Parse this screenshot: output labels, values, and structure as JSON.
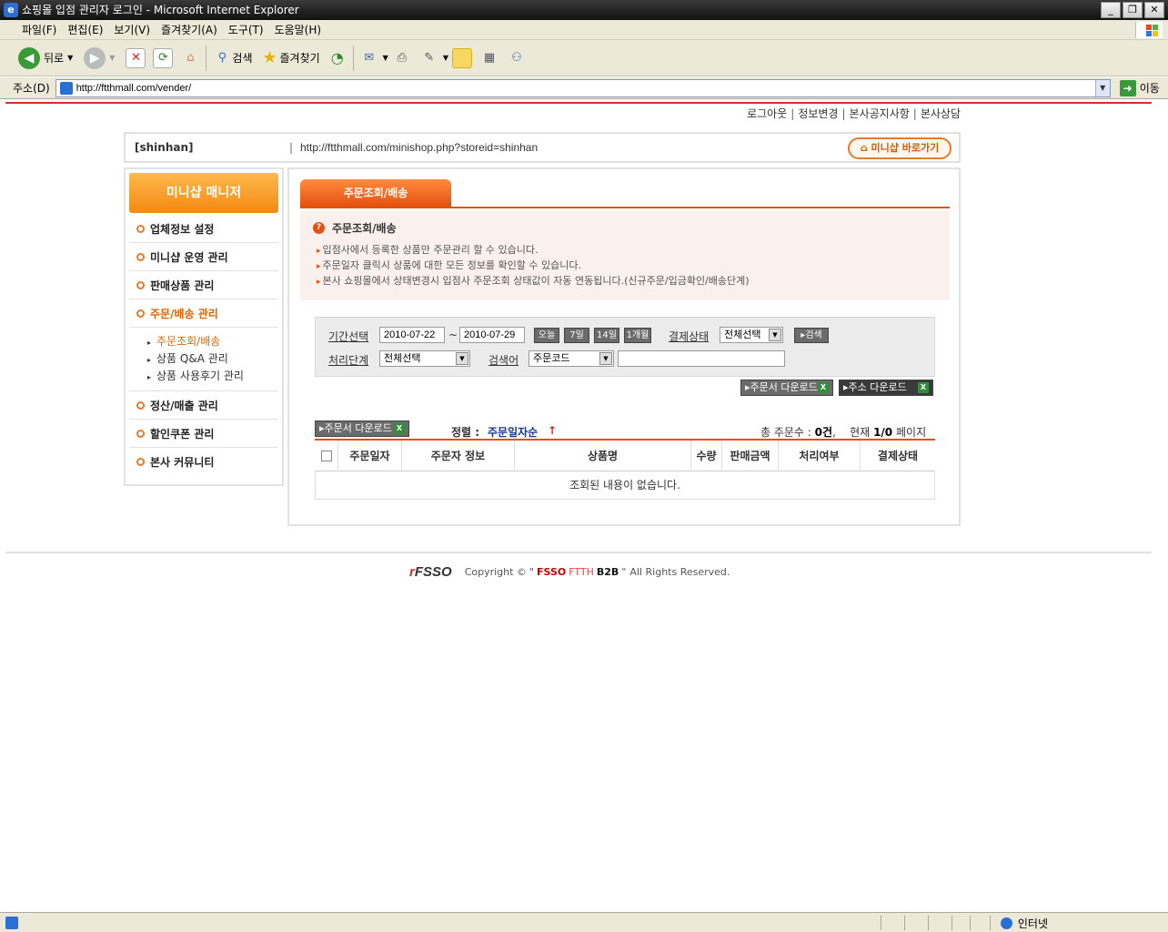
{
  "window": {
    "title": "쇼핑몰 입점 관리자 로그인 - Microsoft Internet Explorer"
  },
  "menu": [
    "파일(F)",
    "편집(E)",
    "보기(V)",
    "즐겨찾기(A)",
    "도구(T)",
    "도움말(H)"
  ],
  "toolbar": {
    "back_label": "뒤로",
    "search_label": "검색",
    "favorites_label": "즐겨찾기"
  },
  "address": {
    "label": "주소(D)",
    "url": "http://ftthmall.com/vender/",
    "go_label": "이동"
  },
  "top_links": [
    "로그아웃",
    "정보변경",
    "본사공지사항",
    "본사상담"
  ],
  "store": {
    "id": "[shinhan]",
    "divider": "|",
    "url": "http://ftthmall.com/minishop.php?storeid=shinhan",
    "minishop_button": "미니샵 바로가기"
  },
  "sidebar": {
    "header": "미니샵 매니저",
    "items": [
      {
        "label": "업체정보 설정"
      },
      {
        "label": "미니샵 운영 관리"
      },
      {
        "label": "판매상품 관리"
      },
      {
        "label": "주문/배송 관리"
      },
      {
        "label": "정산/매출 관리"
      },
      {
        "label": "할인쿠폰 관리"
      },
      {
        "label": "본사 커뮤니티"
      }
    ],
    "sub_items": [
      {
        "label": "주문조회/배송"
      },
      {
        "label": "상품 Q&A 관리"
      },
      {
        "label": "상품 사용후기 관리"
      }
    ]
  },
  "main": {
    "tab": "주문조회/배송",
    "info_title": "주문조회/배송",
    "info_lines": [
      "입점사에서 등록한 상품만 주문관리 할 수 있습니다.",
      "주문일자 클릭시 상품에 대한 모든 정보를 확인할 수 있습니다.",
      "본사 쇼핑몰에서 상태변경시 입점사 주문조회 상태값이 자동 연동됩니다.(신규주문/입금확인/배송단계)"
    ],
    "search": {
      "period_label": "기간선택",
      "date_from": "2010-07-22",
      "tilde": "~",
      "date_to": "2010-07-29",
      "quick": [
        "오늘",
        "7일",
        "14일",
        "1개월"
      ],
      "pay_status_label": "결제상태",
      "pay_status_value": "전체선택",
      "search_button": "검색",
      "step_label": "처리단계",
      "step_value": "전체선택",
      "keyword_label": "검색어",
      "keyword_type": "주문코드",
      "keyword_value": ""
    },
    "download_order": "주문서 다운로드",
    "download_address": "주소 다운로드",
    "download_order_small": "주문서 다운로드",
    "sort_label": "정렬 :",
    "sort_value": "주문일자순",
    "sort_arrow": "↑",
    "total_prefix": "총 주문수 :",
    "total_count": "0건",
    "current_prefix": "현재",
    "current_page": "1/0",
    "page_suffix": "페이지",
    "table": {
      "headers": [
        "주문일자",
        "주문자 정보",
        "상품명",
        "수량",
        "판매금액",
        "처리여부",
        "결제상태"
      ],
      "empty": "조회된 내용이 없습니다."
    }
  },
  "footer": {
    "logo": "FSSO",
    "copyright": "Copyright ©",
    "q1": "\"",
    "fsso": "FSSO",
    "ftth": "FTTH",
    "b2b": "B2B",
    "q2": "\"",
    "rights": "All Rights Reserved."
  },
  "status": {
    "zone": "인터넷"
  }
}
